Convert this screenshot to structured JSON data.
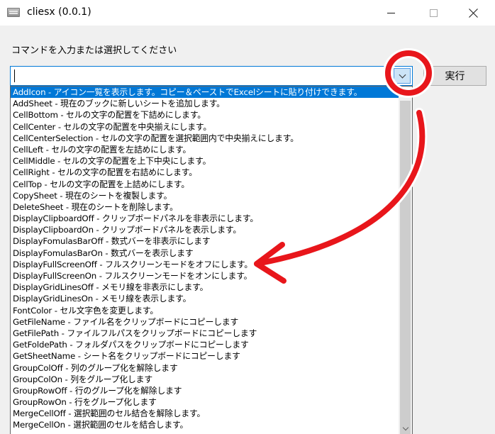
{
  "window": {
    "title": "cliesx (0.0.1)"
  },
  "prompt": "コマンドを入力または選択してください",
  "combo": {
    "value": "",
    "placeholder": ""
  },
  "exec_button": "実行",
  "list": {
    "selected_index": 0,
    "items": [
      "AddIcon - アイコン一覧を表示します。コピー＆ペーストでExcelシートに貼り付けできます。",
      "AddSheet - 現在のブックに新しいシートを追加します。",
      "CellBottom - セルの文字の配置を下詰めにします。",
      "CellCenter - セルの文字の配置を中央揃えにします。",
      "CellCenterSelection - セルの文字の配置を選択範囲内で中央揃えにします。",
      "CellLeft - セルの文字の配置を左詰めにします。",
      "CellMiddle - セルの文字の配置を上下中央にします。",
      "CellRight - セルの文字の配置を右詰めにします。",
      "CellTop - セルの文字の配置を上詰めにします。",
      "CopySheet - 現在のシートを複製します。",
      "DeleteSheet - 現在のシートを削除します。",
      "DisplayClipboardOff - クリップボードパネルを非表示にします。",
      "DisplayClipboardOn - クリップボードパネルを表示します。",
      "DisplayFomulasBarOff - 数式バーを非表示にします",
      "DisplayFomulasBarOn - 数式バーを表示します",
      "DisplayFullScreenOff - フルスクリーンモードをオフにします。",
      "DisplayFullScreenOn - フルスクリーンモードをオンにします。",
      "DisplayGridLinesOff - メモリ線を非表示にします。",
      "DisplayGridLinesOn - メモリ線を表示します。",
      "FontColor - セル文字色を変更します。",
      "GetFileName - ファイル名をクリップボードにコピーします",
      "GetFilePath - ファイルフルパスをクリップボードにコピーします",
      "GetFoldePath - フォルダパスをクリップボードにコピーします",
      "GetSheetName - シート名をクリップボードにコピーします",
      "GroupColOff - 列のグループ化を解除します",
      "GroupColOn - 列をグループ化します",
      "GroupRowOff - 行のグループ化を解除します",
      "GroupRowOn - 行をグループ化します",
      "MergeCellOff - 選択範囲のセル結合を解除します。",
      "MergeCellOn - 選択範囲のセルを結合します。"
    ]
  },
  "icons": {
    "app": "window-app-icon",
    "minimize": "minimize-icon",
    "maximize": "maximize-icon",
    "close": "close-icon",
    "dropdown": "chevron-down-icon",
    "scroll_down": "scroll-down-arrow-icon"
  },
  "colors": {
    "selection": "#0078d7",
    "annotation_red": "#e8161b",
    "arrow_button_bg": "#cce4f7"
  }
}
